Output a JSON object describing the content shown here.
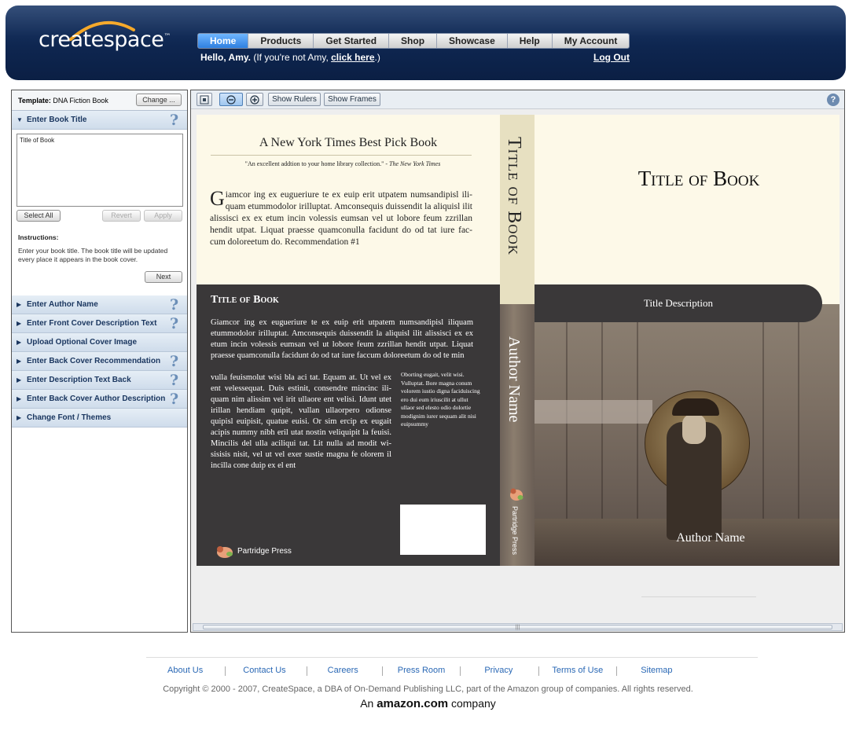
{
  "header": {
    "logo_text": "createspace",
    "logo_tm": "™",
    "nav": [
      "Home",
      "Products",
      "Get Started",
      "Shop",
      "Showcase",
      "Help",
      "My Account"
    ],
    "greeting_name": "Hello, Amy.",
    "greeting_rest": " (If you're not Amy, ",
    "greeting_link": "click here",
    "greeting_end": ".)",
    "logout": "Log Out"
  },
  "left_panel": {
    "template_label": "Template:",
    "template_value": "DNA Fiction Book",
    "change_button": "Change ...",
    "active_section": "Enter Book Title",
    "editor_value": "Title of Book",
    "select_all": "Select All",
    "revert": "Revert",
    "apply": "Apply",
    "instructions_heading": "Instructions:",
    "instructions_text": "Enter your book title.  The book title will be updated every place it appears in the book cover.",
    "next_button": "Next",
    "sections": [
      {
        "label": "Enter Author Name",
        "help": true
      },
      {
        "label": "Enter Front Cover Description Text",
        "help": true
      },
      {
        "label": "Upload Optional Cover Image",
        "help": false
      },
      {
        "label": "Enter Back Cover Recommendation",
        "help": true
      },
      {
        "label": "Enter Description Text Back",
        "help": true
      },
      {
        "label": "Enter Back Cover Author Description",
        "help": true
      },
      {
        "label": "Change Font / Themes",
        "help": false
      }
    ]
  },
  "toolbar": {
    "show_rulers": "Show Rulers",
    "show_frames": "Show Frames",
    "help": "?"
  },
  "cover": {
    "recommendation_heading": "A New York Times Best Pick Book",
    "quote": "\"An excellent addtion to your home library collection.\" - ",
    "quote_source": "The New York Times",
    "rec_drop": "G",
    "rec_body": "iamcor ing ex eugueriure te ex euip erit utpatem numsandipisl ili-quam etummodolor irilluptat. Amconsequis duissendit la aliquisl ilit alissisci ex ex etum incin volessis eumsan vel ut lobore feum zzrillan hendit utpat. Liquat praesse quamconulla facidunt do od tat iure fac-cum doloreetum do.          Recommendation #1",
    "back_title": "Title of Book",
    "back_desc_full": "Giamcor ing ex eugueriure te ex euip erit utpatem numsandipisl iliquam etummodolor irilluptat. Amconsequis duissendit la aliquisl ilit alissisci ex ex etum incin volessis eumsan vel ut lobore feum zzrillan hendit utpat. Liquat praesse quamconulla facidunt do od tat iure faccum doloreetum do od te min",
    "back_desc_col": "vulla feuismolut wisi bla aci tat. Equam at. Ut vel ex ent velessequat. Duis estinit, consendre mincinc ili-quam nim alissim vel irit ullaore ent velisi. Idunt utet irillan hendiam quipit, vullan ullaorpero odionse quipisl euipisit, quatue euisi. Or sim ercip ex eugait acipis nummy nibh eril utat nostin veliquipit la feuisi. Mincilis del ulla aciliqui tat. Lit nulla ad modit wi-sisisis nisit, vel ut vel exer sustie magna fe olorem il incilla cone duip ex el ent",
    "back_author_desc": "Oborting eugait, velit wisi. Vulluptat. Bore magna conum volorem iustio digna faciduiscing ero dui eum iriuscilit at ullut ullaor sed elesto odio dolortie modignim iurer sequam alit nisi euipsummy",
    "publisher": "Partridge Press",
    "spine_title": "Title of Book",
    "spine_author": "Author Name",
    "spine_publisher": "Partridge Press",
    "front_title": "Title of Book",
    "title_description": "Title Description",
    "author_name": "Author Name"
  },
  "footer": {
    "links": [
      "About Us",
      "Contact Us",
      "Careers",
      "Press Room",
      "Privacy",
      "Terms of Use",
      "Sitemap"
    ],
    "copyright": "Copyright © 2000 - 2007, CreateSpace, a DBA of On-Demand Publishing LLC, part of the Amazon group of companies. All rights reserved.",
    "amazon_an": "An ",
    "amazon_brand": "amazon.com",
    "amazon_company": " company"
  },
  "colors": {
    "header_bg": "#0e2650",
    "nav_active": "#2f7fe0",
    "section_text": "#1b3760",
    "cover_cream": "#fdf9e8",
    "cover_dark": "#3a3839",
    "footer_link": "#2a68b5"
  },
  "icons": [
    "help-question-icon",
    "triangle-down-icon",
    "triangle-right-icon",
    "fit-page-icon",
    "zoom-out-icon",
    "zoom-in-icon",
    "partridge-logo-icon"
  ]
}
